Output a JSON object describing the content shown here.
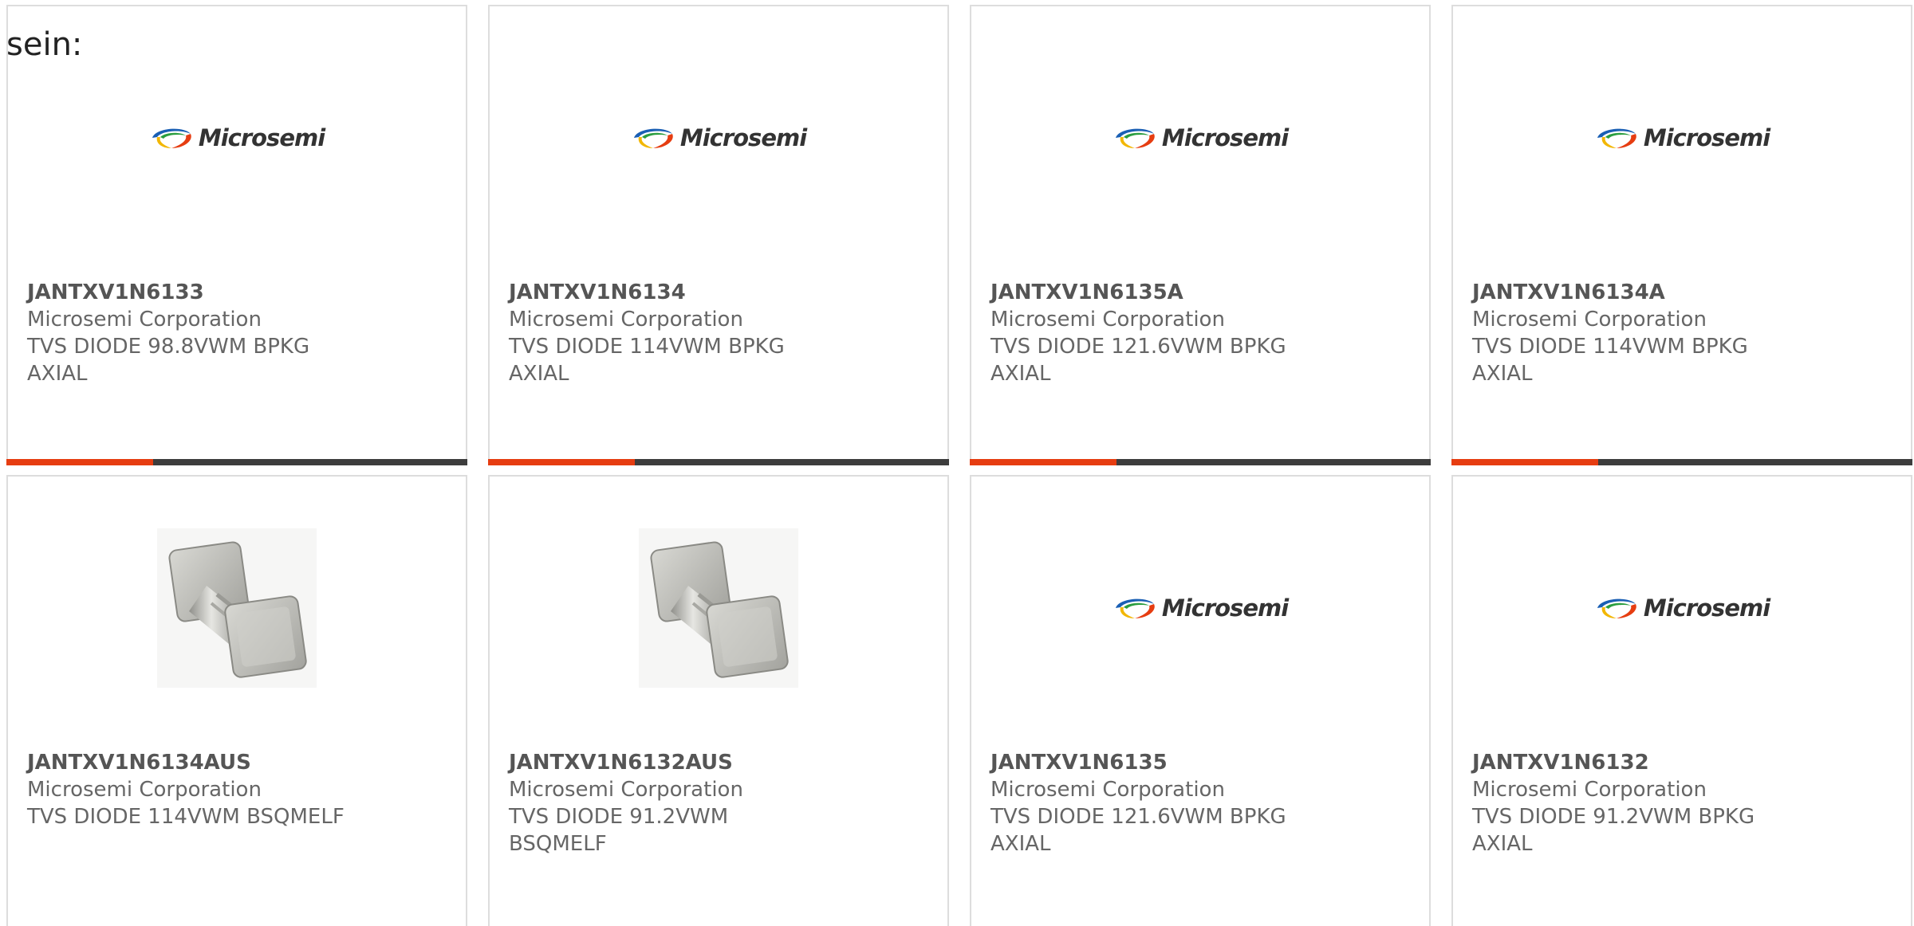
{
  "intro": {
    "text": "sein:"
  },
  "colors": {
    "accent": "#e63d11",
    "bar": "#3d3d3d",
    "border": "#dddddd",
    "text": "#666666"
  },
  "cards": [
    {
      "part_number": "JANTXV1N6133",
      "manufacturer": "Microsemi Corporation",
      "description": "TVS DIODE 98.8VWM BPKG AXIAL",
      "image": "microsemi-logo",
      "logo_text": "Microsemi"
    },
    {
      "part_number": "JANTXV1N6134",
      "manufacturer": "Microsemi Corporation",
      "description": "TVS DIODE 114VWM BPKG AXIAL",
      "image": "microsemi-logo",
      "logo_text": "Microsemi"
    },
    {
      "part_number": "JANTXV1N6135A",
      "manufacturer": "Microsemi Corporation",
      "description": "TVS DIODE 121.6VWM BPKG AXIAL",
      "image": "microsemi-logo",
      "logo_text": "Microsemi"
    },
    {
      "part_number": "JANTXV1N6134A",
      "manufacturer": "Microsemi Corporation",
      "description": "TVS DIODE 114VWM BPKG AXIAL",
      "image": "microsemi-logo",
      "logo_text": "Microsemi"
    },
    {
      "part_number": "JANTXV1N6134AUS",
      "manufacturer": "Microsemi Corporation",
      "description": "TVS DIODE 114VWM BSQMELF",
      "image": "melf-component-photo",
      "logo_text": ""
    },
    {
      "part_number": "JANTXV1N6132AUS",
      "manufacturer": "Microsemi Corporation",
      "description": "TVS DIODE 91.2VWM BSQMELF",
      "image": "melf-component-photo",
      "logo_text": ""
    },
    {
      "part_number": "JANTXV1N6135",
      "manufacturer": "Microsemi Corporation",
      "description": "TVS DIODE 121.6VWM BPKG AXIAL",
      "image": "microsemi-logo",
      "logo_text": "Microsemi"
    },
    {
      "part_number": "JANTXV1N6132",
      "manufacturer": "Microsemi Corporation",
      "description": "TVS DIODE 91.2VWM BPKG AXIAL",
      "image": "microsemi-logo",
      "logo_text": "Microsemi"
    }
  ]
}
